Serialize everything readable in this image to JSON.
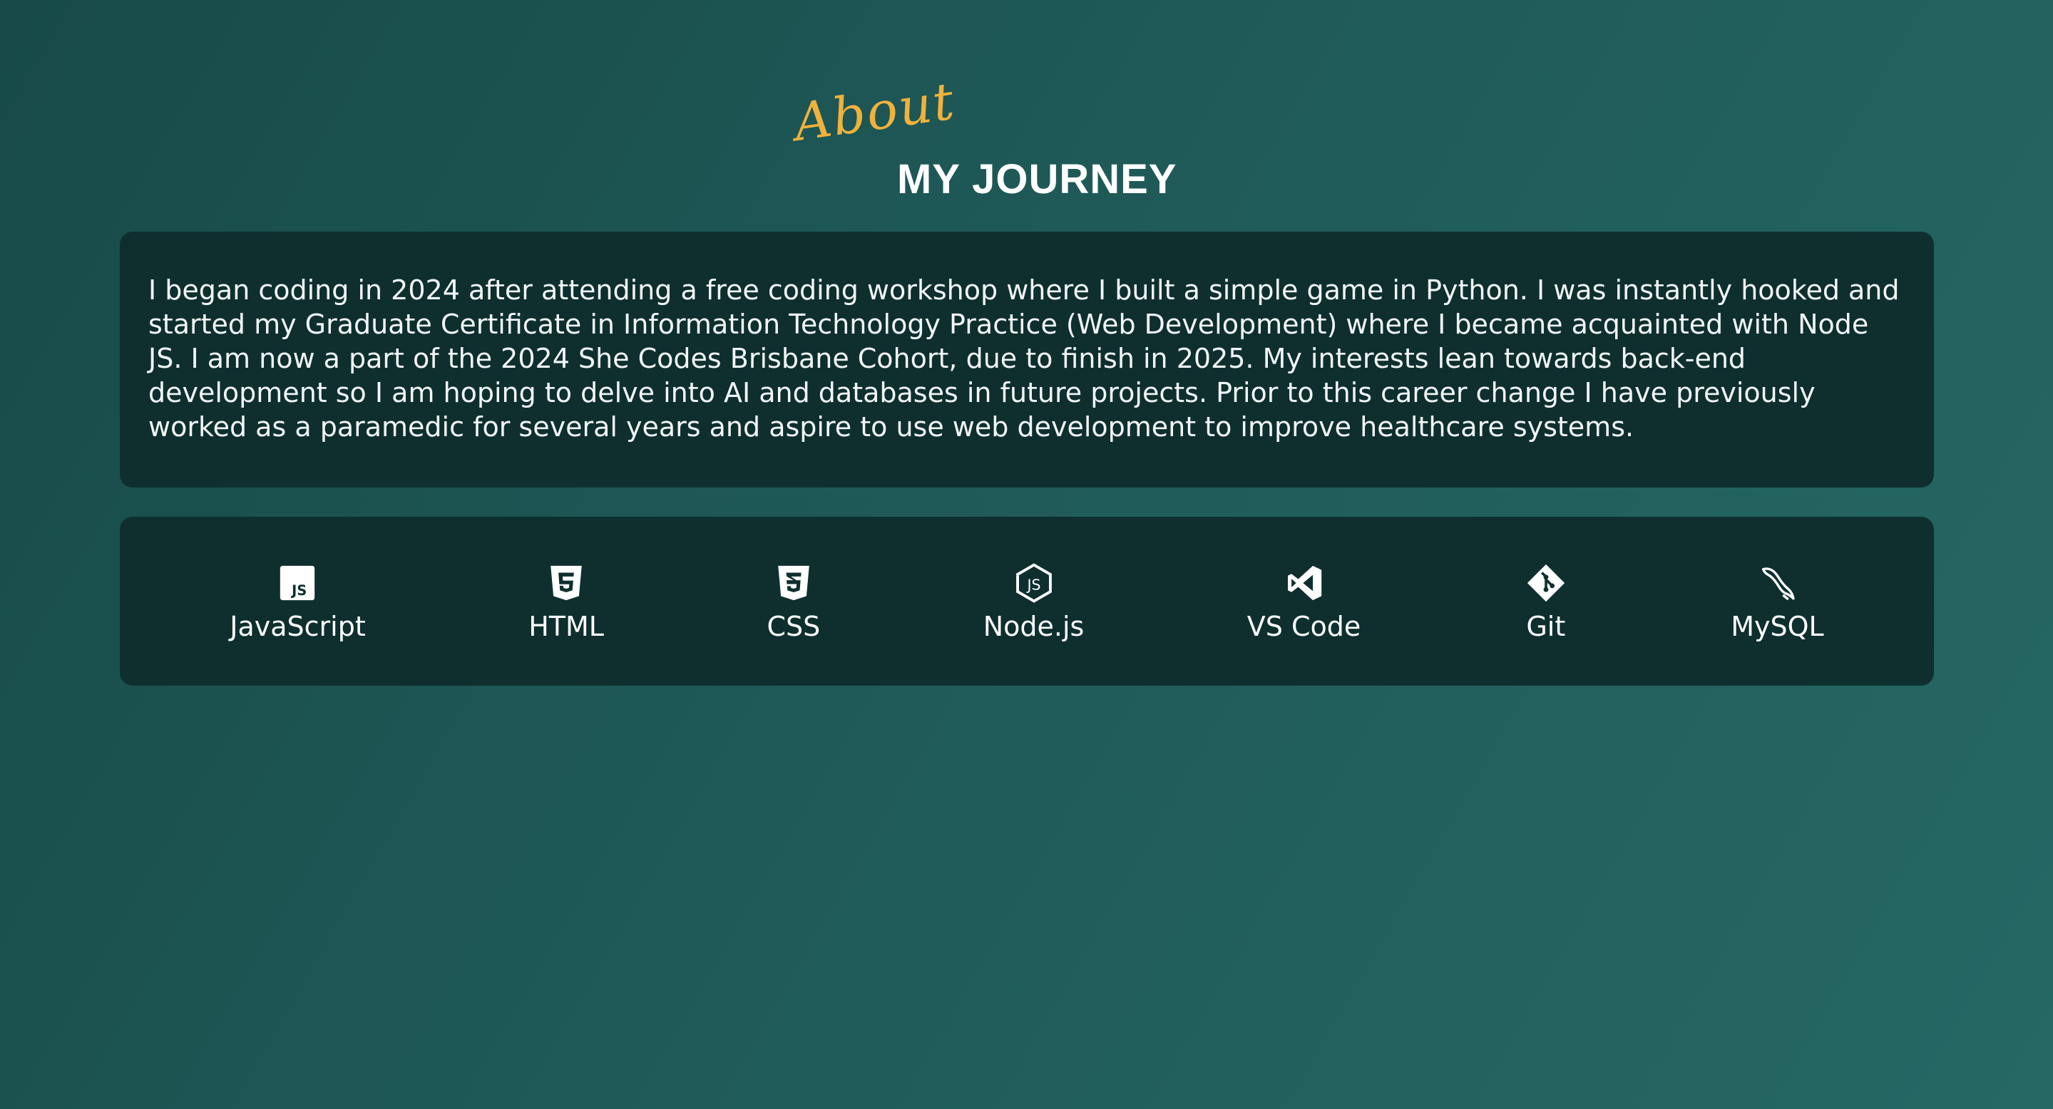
{
  "section": {
    "script_label": "About",
    "title": "MY JOURNEY",
    "paragraph": "I began coding in 2024 after attending a free coding workshop where I built a simple game in Python. I was instantly hooked and started my Graduate Certificate in Information Technology Practice (Web Development) where I became acquainted with Node JS. I am now a part of the 2024 She Codes Brisbane Cohort, due to finish in 2025. My interests lean towards back-end development so I am hoping to delve into AI and databases in future projects. Prior to this career change I have previously worked as a paramedic for several years and aspire to use web development to improve healthcare systems."
  },
  "skills": [
    {
      "label": "JavaScript",
      "icon": "javascript-icon"
    },
    {
      "label": "HTML",
      "icon": "html5-icon"
    },
    {
      "label": "CSS",
      "icon": "css3-icon"
    },
    {
      "label": "Node.js",
      "icon": "nodejs-icon"
    },
    {
      "label": "VS Code",
      "icon": "vscode-icon"
    },
    {
      "label": "Git",
      "icon": "git-icon"
    },
    {
      "label": "MySQL",
      "icon": "mysql-icon"
    }
  ],
  "colors": {
    "accent": "#f0b23c",
    "card_background": "#0f2f2f",
    "page_background": "#1f5a58",
    "text": "#ffffff"
  }
}
